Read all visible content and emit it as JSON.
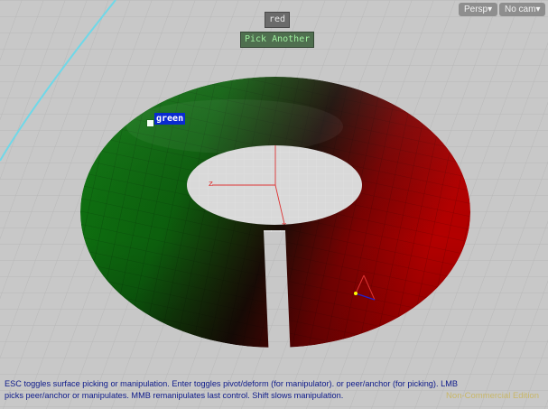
{
  "viewport": {
    "selection_label": "red",
    "pick_button": "Pick Another",
    "view_menu": "Persp",
    "camera_menu": "No cam",
    "object_label": "green",
    "axis_label_y": "y",
    "axis_label_z": "z",
    "axis_label_x": "x"
  },
  "status_bar": {
    "hint_line_1": "ESC toggles surface picking or manipulation.  Enter toggles pivot/deform (for manipulator).  or peer/anchor (for picking).  LMB",
    "hint_line_2": "picks peer/anchor or manipulates.  MMB remanipulates last control.  Shift slows manipulation.",
    "edition": "Non-Commercial Edition"
  },
  "colors": {
    "background": "#c8c8c8",
    "torus_green": "#0f7a12",
    "torus_red": "#b30000",
    "label_highlight": "#0a2ad0",
    "status_text": "#0d1a8a"
  }
}
